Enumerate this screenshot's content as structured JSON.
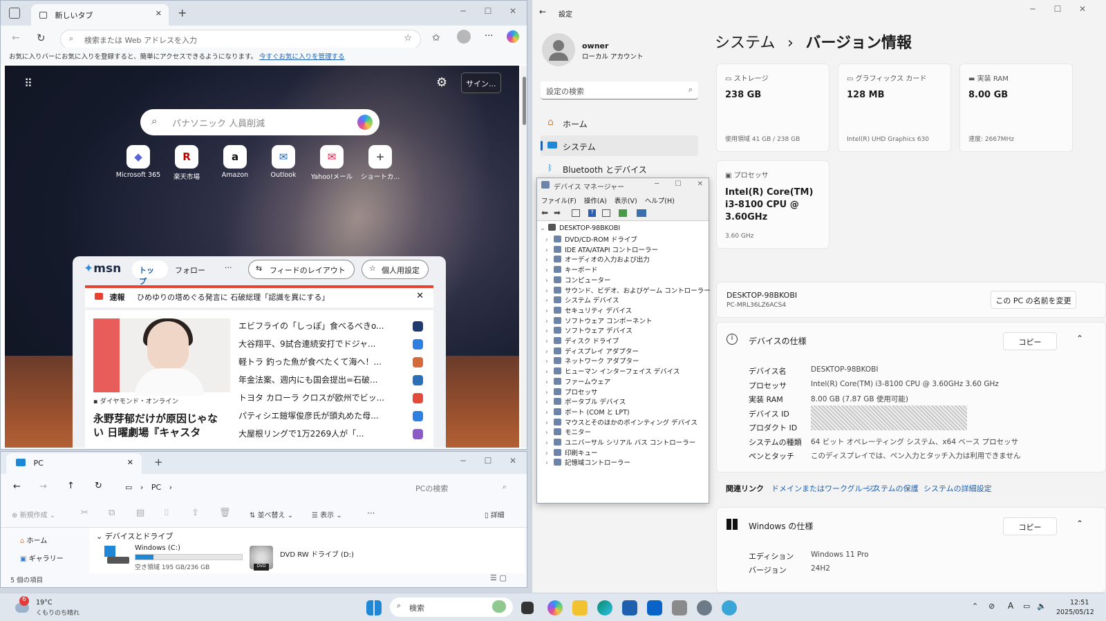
{
  "edge": {
    "tab_title": "新しいタブ",
    "address_placeholder": "検索または Web アドレスを入力",
    "favbar_text": "お気に入りバーにお気に入りを登録すると、簡単にアクセスできるようになります。",
    "favbar_link": "今すぐお気に入りを管理する",
    "signin_label": "サイン...",
    "search_text": "パナソニック 人員削減",
    "quicklinks": [
      {
        "label": "Microsoft 365",
        "glyph": "◆",
        "color": "#5a63d6"
      },
      {
        "label": "楽天市場",
        "glyph": "R",
        "color": "#bf0000"
      },
      {
        "label": "Amazon",
        "glyph": "a",
        "color": "#111111"
      },
      {
        "label": "Outlook",
        "glyph": "✉",
        "color": "#0a64c8"
      },
      {
        "label": "Yahoo!メール",
        "glyph": "✉",
        "color": "#ff0033"
      },
      {
        "label": "ショートカ...",
        "glyph": "+",
        "color": "#555555"
      }
    ],
    "msn": {
      "logo": "msn",
      "tab_top": "トップ",
      "tab_follow": "フォロー",
      "more": "···",
      "layout_button": "フィードのレイアウト",
      "personalize_button": "個人用設定",
      "breaking_label": "速報",
      "breaking_text": "ひめゆりの塔めぐる発言に 石破総理「認識を異にする」",
      "source": "ダイヤモンド・オンライン",
      "feature_title": "永野芽郁だけが原因じゃな",
      "feature_title_2": "い 日曜劇場『キャスタ",
      "headlines": [
        {
          "text": "エビフライの「しっぽ」食べるべきo...",
          "color": "#1e3a6e"
        },
        {
          "text": "大谷翔平、9試合連続安打でドジャ...",
          "color": "#2d7fe0"
        },
        {
          "text": "軽トラ 釣った魚が食べたくて海へ！...",
          "color": "#d46a3a"
        },
        {
          "text": "年金法案、週内にも国会提出=石破...",
          "color": "#2a6fb8"
        },
        {
          "text": "トヨタ カローラ クロスが欧州でビッ...",
          "color": "#e24a3a"
        },
        {
          "text": "パティシエ鎧塚俊彦氏が頭丸めた母...",
          "color": "#2d7fe0"
        },
        {
          "text": "大屋根リングで1万2269人が「...",
          "color": "#8a5cc7"
        }
      ]
    }
  },
  "explorer": {
    "tab_title": "PC",
    "breadcrumb": "PC",
    "search_placeholder": "PCの検索",
    "new_label": "新規作成",
    "sort_label": "並べ替え",
    "view_label": "表示",
    "more": "···",
    "details_label": "詳細",
    "side_home": "ホーム",
    "side_gallery": "ギャラリー",
    "section": "デバイスとドライブ",
    "drive_c_name": "Windows (C:)",
    "drive_c_free": "空き領域 195 GB/236 GB",
    "drive_c_used_fraction": 0.17,
    "drive_d_name": "DVD RW ドライブ (D:)",
    "dvd_badge": "DVD",
    "status": "5 個の項目"
  },
  "settings": {
    "app_title": "設定",
    "user_name": "owner",
    "user_type": "ローカル アカウント",
    "search_placeholder": "設定の検索",
    "nav": [
      {
        "label": "ホーム"
      },
      {
        "label": "システム"
      },
      {
        "label": "Bluetooth とデバイス"
      }
    ],
    "title_parent": "システム",
    "title_sep": "›",
    "title_page": "バージョン情報",
    "cards": [
      {
        "title": "ストレージ",
        "value": "238 GB",
        "sub": "使用領域 41 GB / 238 GB"
      },
      {
        "title": "グラフィックス カード",
        "value": "128 MB",
        "sub": "Intel(R) UHD Graphics 630"
      },
      {
        "title": "実装 RAM",
        "value": "8.00 GB",
        "sub": "速度: 2667MHz"
      }
    ],
    "cpu_card": {
      "title": "プロセッサ",
      "value_1": "Intel(R) Core(TM)",
      "value_2": "i3-8100 CPU @",
      "value_3": "3.60GHz",
      "sub": "3.60 GHz"
    },
    "pc_name": "DESKTOP-98BKOBI",
    "pc_model": "PC-MRL36LZ6ACS4",
    "rename_button": "この PC の名前を変更",
    "device_spec_title": "デバイスの仕様",
    "copy_label": "コピー",
    "device_spec": [
      {
        "label": "デバイス名",
        "value": "DESKTOP-98BKOBI"
      },
      {
        "label": "プロセッサ",
        "value": "Intel(R) Core(TM) i3-8100 CPU @ 3.60GHz   3.60 GHz"
      },
      {
        "label": "実装 RAM",
        "value": "8.00 GB (7.87 GB 使用可能)"
      },
      {
        "label": "デバイス ID",
        "value": ""
      },
      {
        "label": "プロダクト ID",
        "value": ""
      },
      {
        "label": "システムの種類",
        "value": "64 ビット オペレーティング システム、x64 ベース プロセッサ"
      },
      {
        "label": "ペンとタッチ",
        "value": "このディスプレイでは、ペン入力とタッチ入力は利用できません"
      }
    ],
    "related_label": "関連リンク",
    "related_links": [
      "ドメインまたはワークグループ",
      "システムの保護",
      "システムの詳細設定"
    ],
    "windows_spec_title": "Windows の仕様",
    "windows_spec": [
      {
        "label": "エディション",
        "value": "Windows 11 Pro"
      },
      {
        "label": "バージョン",
        "value": "24H2"
      }
    ]
  },
  "devmgr": {
    "title": "デバイス マネージャー",
    "menu": "ファイル(F)  操作(A)  表示(V)  ヘルプ(H)",
    "root": "DESKTOP-98BKOBI",
    "items": [
      "DVD/CD-ROM ドライブ",
      "IDE ATA/ATAPI コントローラー",
      "オーディオの入力および出力",
      "キーボード",
      "コンピューター",
      "サウンド、ビデオ、およびゲーム コントローラー",
      "システム デバイス",
      "セキュリティ デバイス",
      "ソフトウェア コンポーネント",
      "ソフトウェア デバイス",
      "ディスク ドライブ",
      "ディスプレイ アダプター",
      "ネットワーク アダプター",
      "ヒューマン インターフェイス デバイス",
      "ファームウェア",
      "プロセッサ",
      "ポータブル デバイス",
      "ポート (COM と LPT)",
      "マウスとそのほかのポインティング デバイス",
      "モニター",
      "ユニバーサル シリアル バス コントローラー",
      "印刷キュー",
      "記憶域コントローラー"
    ]
  },
  "taskbar": {
    "weather_badge": "6",
    "temp": "19°C",
    "weather": "くもりのち晴れ",
    "search": "検索",
    "time": "12:51",
    "date": "2025/05/12",
    "ime": "A"
  }
}
